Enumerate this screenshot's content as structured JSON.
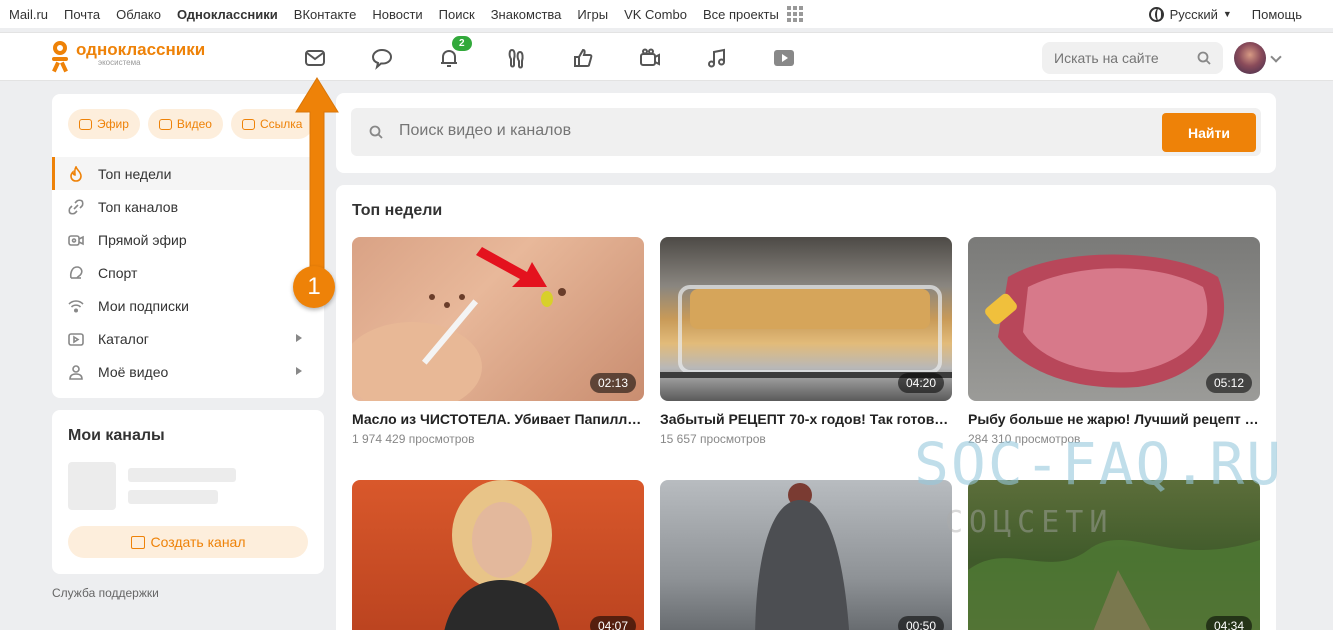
{
  "portal": {
    "links": [
      "Mail.ru",
      "Почта",
      "Облако",
      "Одноклассники",
      "ВКонтакте",
      "Новости",
      "Поиск",
      "Знакомства",
      "Игры",
      "VK Combo",
      "Все проекты"
    ],
    "active": "Одноклассники",
    "language": "Русский",
    "help": "Помощь"
  },
  "header": {
    "logo_text": "одноклассники",
    "logo_sub": "экосистема",
    "notifications_badge": "2",
    "nav_icons": [
      "mail-icon",
      "chat-icon",
      "bell-icon",
      "guests-icon",
      "likes-icon",
      "camera-icon",
      "music-icon",
      "video-icon"
    ],
    "search_placeholder": "Искать на сайте"
  },
  "sidebar": {
    "pills": [
      "Эфир",
      "Видео",
      "Ссылка"
    ],
    "menu": [
      {
        "label": "Топ недели",
        "icon": "flame-icon",
        "active": true,
        "has_arrow": false
      },
      {
        "label": "Топ каналов",
        "icon": "link-icon",
        "active": false,
        "has_arrow": false
      },
      {
        "label": "Прямой эфир",
        "icon": "live-icon",
        "active": false,
        "has_arrow": false
      },
      {
        "label": "Спорт",
        "icon": "sport-icon",
        "active": false,
        "has_arrow": false
      },
      {
        "label": "Мои подписки",
        "icon": "wifi-icon",
        "active": false,
        "has_arrow": false
      },
      {
        "label": "Каталог",
        "icon": "catalog-icon",
        "active": false,
        "has_arrow": true
      },
      {
        "label": "Моё видео",
        "icon": "user-icon",
        "active": false,
        "has_arrow": true
      }
    ],
    "channels_title": "Мои каналы",
    "create_channel": "Создать канал",
    "support": "Служба поддержки"
  },
  "video_search": {
    "placeholder": "Поиск видео и каналов",
    "button": "Найти"
  },
  "main": {
    "section_title": "Топ недели",
    "videos": [
      {
        "title": "Масло из ЧИСТОТЕЛА. Убивает Папилл…",
        "views": "1 974 429 просмотров",
        "duration": "02:13"
      },
      {
        "title": "Забытый РЕЦЕПТ 70-х годов! Так готов…",
        "views": "15 657 просмотров",
        "duration": "04:20"
      },
      {
        "title": "Рыбу больше не жарю! Лучший рецепт …",
        "views": "284 310 просмотров",
        "duration": "05:12"
      },
      {
        "title": "",
        "views": "",
        "duration": "04:07"
      },
      {
        "title": "",
        "views": "",
        "duration": "00:50"
      },
      {
        "title": "",
        "views": "",
        "duration": "04:34"
      }
    ]
  },
  "annotation": {
    "step_number": "1",
    "watermark_main": "SOC-FAQ.RU",
    "watermark_sub": "СОЦСЕТИ"
  },
  "colors": {
    "accent": "#ee8208",
    "badge_green": "#32a93b"
  }
}
